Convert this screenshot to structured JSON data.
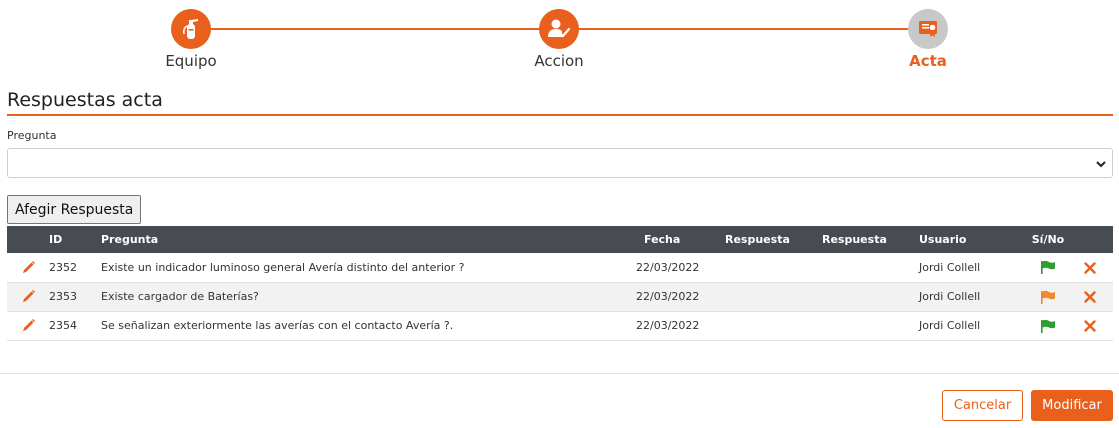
{
  "stepper": {
    "steps": [
      {
        "label": "Equipo",
        "icon": "fire-extinguisher-icon",
        "state": "done"
      },
      {
        "label": "Accion",
        "icon": "user-check-icon",
        "state": "done"
      },
      {
        "label": "Acta",
        "icon": "certificate-icon",
        "state": "current"
      }
    ]
  },
  "section": {
    "title": "Respuestas acta"
  },
  "form": {
    "pregunta_label": "Pregunta",
    "pregunta_value": "",
    "add_button": "Afegir Respuesta"
  },
  "table": {
    "headers": {
      "id": "ID",
      "pregunta": "Pregunta",
      "fecha": "Fecha",
      "respuesta1": "Respuesta",
      "respuesta2": "Respuesta",
      "usuario": "Usuario",
      "sino": "Sí/No"
    },
    "rows": [
      {
        "id": "2352",
        "pregunta": "Existe un indicador luminoso general Avería distinto del anterior ?",
        "fecha": "22/03/2022",
        "respuesta1": "",
        "respuesta2": "",
        "usuario": "Jordi Collell",
        "flag": "green"
      },
      {
        "id": "2353",
        "pregunta": "Existe cargador de Baterías?",
        "fecha": "22/03/2022",
        "respuesta1": "",
        "respuesta2": "",
        "usuario": "Jordi Collell",
        "flag": "orange"
      },
      {
        "id": "2354",
        "pregunta": "Se señalizan exteriormente las averías con el contacto Avería ?.",
        "fecha": "22/03/2022",
        "respuesta1": "",
        "respuesta2": "",
        "usuario": "Jordi Collell",
        "flag": "green"
      }
    ]
  },
  "actions": {
    "cancel": "Cancelar",
    "save": "Modificar"
  },
  "colors": {
    "accent": "#e8601c",
    "header_bg": "#464c52",
    "flag_green": "#2e9e2e",
    "flag_orange": "#f08a2c",
    "step_pending": "#c8c8c8"
  }
}
